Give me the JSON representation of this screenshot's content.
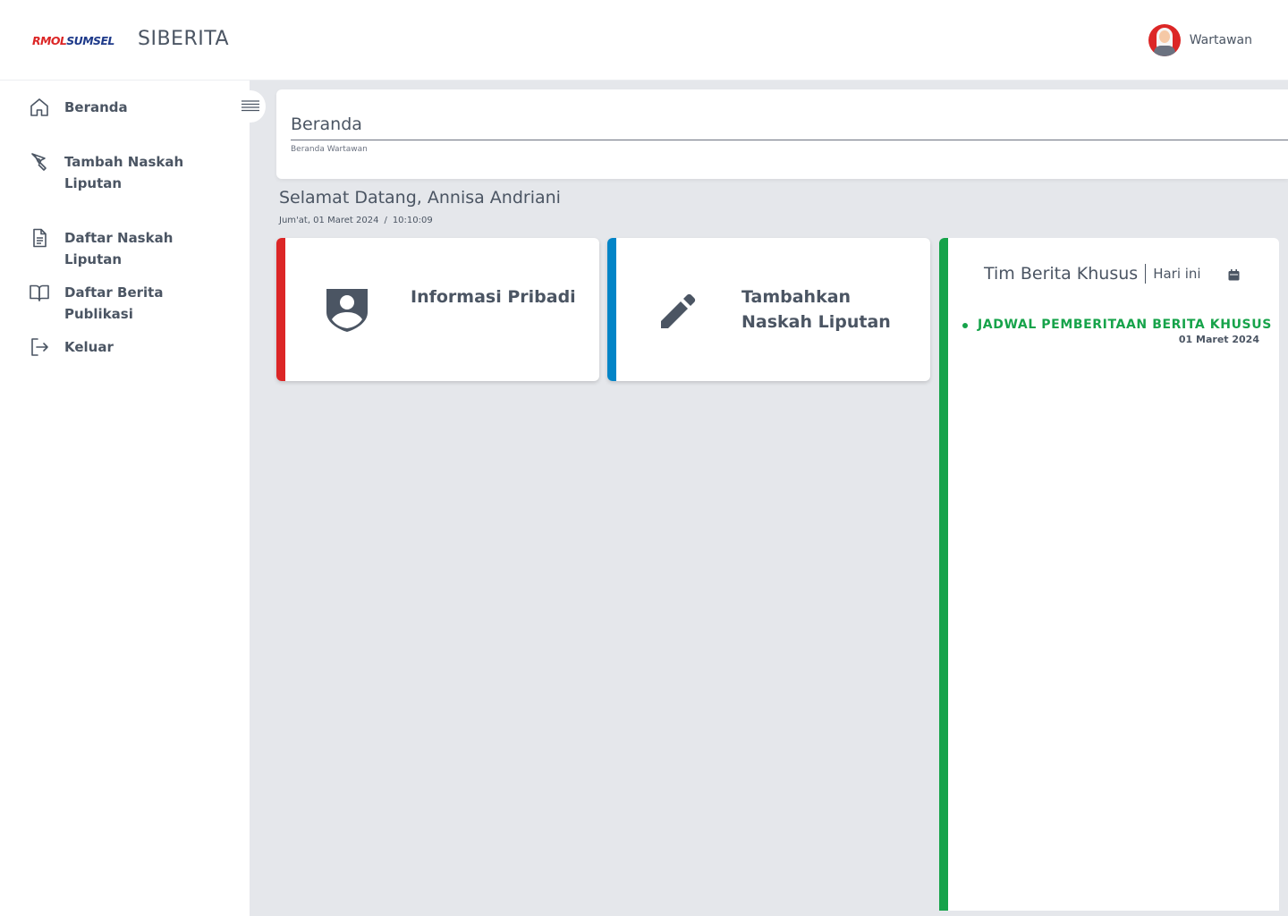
{
  "header": {
    "logo": {
      "part1": "RMOL",
      "part2": "SUMSEL"
    },
    "app_title": "SIBERITA",
    "user_role": "Wartawan"
  },
  "sidebar": {
    "items": [
      {
        "label": "Beranda",
        "icon": "home-icon"
      },
      {
        "label": "Tambah Naskah Liputan",
        "icon": "pen-tool-icon"
      },
      {
        "label": "Daftar Naskah Liputan",
        "icon": "document-icon"
      },
      {
        "label": "Daftar Berita Publikasi",
        "icon": "book-icon"
      },
      {
        "label": "Keluar",
        "icon": "logout-icon"
      }
    ]
  },
  "page": {
    "title": "Beranda",
    "breadcrumb": "Beranda Wartawan",
    "welcome": "Selamat Datang, Annisa Andriani",
    "date": "Jum'at, 01 Maret 2024",
    "separator": "/",
    "time": "10:10:09"
  },
  "cards": [
    {
      "label": "Informasi Pribadi",
      "icon": "user-shield-icon",
      "accent": "#dc2626"
    },
    {
      "label": "Tambahkan Naskah Liputan",
      "icon": "pencil-icon",
      "accent": "#0284c7"
    }
  ],
  "panel": {
    "title": "Tim Berita Khusus",
    "subtitle": "Hari ini",
    "accent": "#16a34a",
    "events": [
      {
        "title": "JADWAL PEMBERITAAN BERITA KHUSUS",
        "date": "01 Maret 2024"
      }
    ]
  }
}
